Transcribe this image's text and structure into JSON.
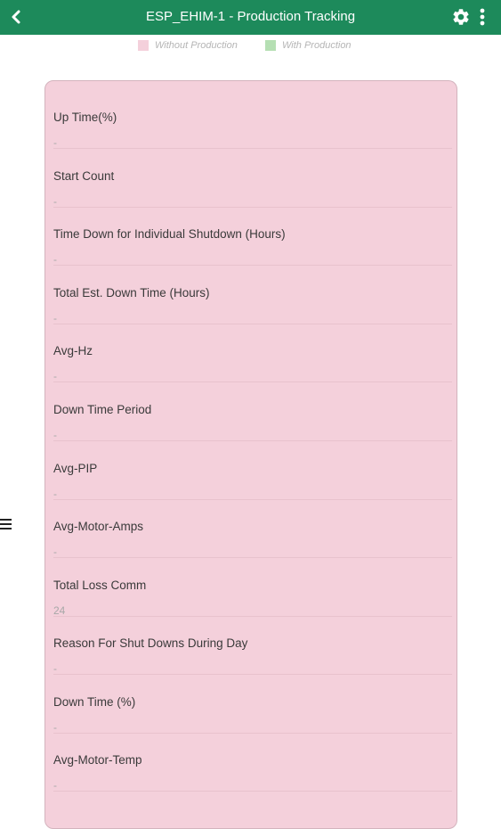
{
  "appbar": {
    "title": "ESP_EHIM-1 - Production Tracking",
    "color": "#1d8a5b",
    "back_icon": "chevron-left-icon",
    "settings_icon": "gear-icon",
    "overflow_icon": "more-vert-icon"
  },
  "legend": {
    "items": [
      {
        "label": "Without Production",
        "color": "#f4d0db"
      },
      {
        "label": "With Production",
        "color": "#b5dfb3"
      }
    ]
  },
  "side_menu_icon": "hamburger-menu-icon",
  "card": {
    "background": "#f4d0db",
    "fields": [
      {
        "label": "Up Time(%)",
        "value": "-"
      },
      {
        "label": "Start Count",
        "value": "-"
      },
      {
        "label": "Time Down for Individual Shutdown (Hours)",
        "value": "-"
      },
      {
        "label": "Total Est. Down Time (Hours)",
        "value": "-"
      },
      {
        "label": "Avg-Hz",
        "value": "-"
      },
      {
        "label": "Down Time Period",
        "value": "-"
      },
      {
        "label": "Avg-PIP",
        "value": "-"
      },
      {
        "label": "Avg-Motor-Amps",
        "value": "-"
      },
      {
        "label": "Total Loss Comm",
        "value": "24"
      },
      {
        "label": "Reason For Shut Downs During Day",
        "value": "-"
      },
      {
        "label": "Down Time (%)",
        "value": "-"
      },
      {
        "label": "Avg-Motor-Temp",
        "value": "-"
      }
    ]
  }
}
